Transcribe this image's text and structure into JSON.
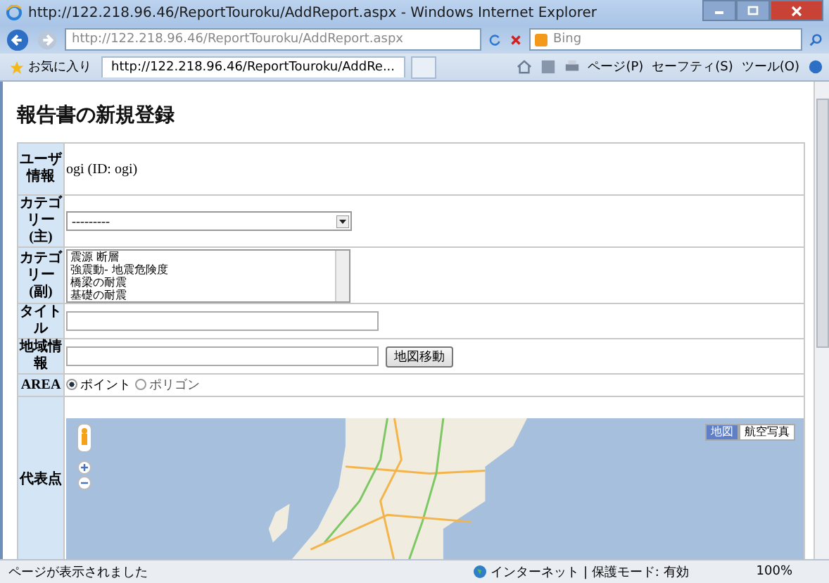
{
  "window": {
    "title": "http://122.218.96.46/ReportTouroku/AddReport.aspx - Windows Internet Explorer"
  },
  "address_bar": {
    "url": "http://122.218.96.46/ReportTouroku/AddReport.aspx"
  },
  "search": {
    "placeholder": "Bing"
  },
  "favorites": {
    "label": "お気に入り"
  },
  "tabs": [
    {
      "label": "http://122.218.96.46/ReportTouroku/AddRe...",
      "selected": true
    }
  ],
  "command_bar": [
    "ページ(P)",
    "セーフティ(S)",
    "ツール(O)"
  ],
  "page": {
    "heading": "報告書の新規登録",
    "rows": [
      {
        "label": "ユーザ情報",
        "kind": "text",
        "value": "ogi (ID: ogi)"
      },
      {
        "label": "カテゴリー(主)",
        "kind": "select",
        "value": "---------"
      },
      {
        "label": "カテゴリー(副)",
        "kind": "listbox",
        "options": [
          "震源 断層",
          "強震動- 地震危険度",
          "橋梁の耐震",
          "基礎の耐震"
        ]
      },
      {
        "label": "タイトル",
        "kind": "input"
      },
      {
        "label": "地域情報",
        "kind": "input_button",
        "button": "地図移動"
      },
      {
        "label": "AREA",
        "kind": "radio",
        "options": [
          {
            "label": "ポイント",
            "selected": true
          },
          {
            "label": "ポリゴン",
            "selected": false
          }
        ]
      },
      {
        "label": "代表点",
        "kind": "map",
        "map_types": [
          {
            "label": "地図",
            "selected": true
          },
          {
            "label": "航空写真",
            "selected": false
          }
        ]
      }
    ]
  },
  "status_bar": {
    "text": "ページが表示されました",
    "zone": "インターネット | 保護モード: 有効",
    "zoom": "100%"
  }
}
